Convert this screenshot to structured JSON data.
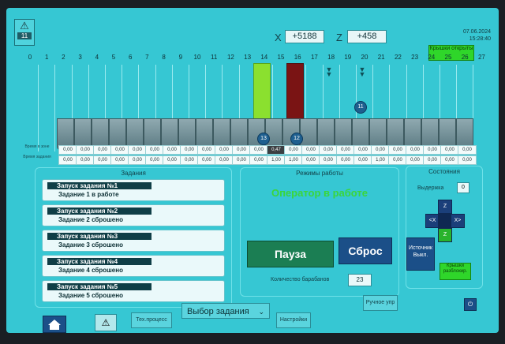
{
  "header": {
    "alarm_count": "11",
    "x_label": "X",
    "x_value": "+5188",
    "z_label": "Z",
    "z_value": "+458",
    "date": "07.06.2024",
    "time": "15:28:40",
    "green_button": "Крышки открыты"
  },
  "columns": [
    "0",
    "1",
    "2",
    "3",
    "4",
    "5",
    "6",
    "7",
    "8",
    "9",
    "10",
    "11",
    "12",
    "13",
    "14",
    "15",
    "16",
    "17",
    "18",
    "19",
    "20",
    "21",
    "22",
    "23",
    "24",
    "25",
    "26",
    "27"
  ],
  "markers": {
    "m13": "13",
    "m15": "12",
    "m19": "11"
  },
  "rows": {
    "row1_label": "Время в зоне",
    "row2_label": "Время задания",
    "row1": [
      "0,00",
      "0,00",
      "0,00",
      "0,00",
      "0,00",
      "0,00",
      "0,00",
      "0,00",
      "0,00",
      "0,00",
      "0,00",
      "0,00",
      "0,47",
      "0,00",
      "0,00",
      "0,00",
      "0,00",
      "0,00",
      "0,00",
      "0,00",
      "0,00",
      "0,00",
      "0,00",
      "0,00"
    ],
    "row2": [
      "0,00",
      "0,00",
      "0,00",
      "0,00",
      "0,00",
      "0,00",
      "0,00",
      "0,00",
      "0,00",
      "0,00",
      "0,00",
      "0,00",
      "1,00",
      "1,00",
      "0,00",
      "0,00",
      "0,00",
      "0,00",
      "1,00",
      "0,00",
      "0,00",
      "0,00",
      "0,00",
      "0,00"
    ]
  },
  "tasks": {
    "title": "Задания",
    "items": [
      {
        "head": "Запуск задания №1",
        "sub": "Задание 1 в работе"
      },
      {
        "head": "Запуск задания №2",
        "sub": "Задание 2 сброшено"
      },
      {
        "head": "Запуск задания №3",
        "sub": "Задание 3 сброшено"
      },
      {
        "head": "Запуск задания №4",
        "sub": "Задание 4 сброшено"
      },
      {
        "head": "Запуск задания №5",
        "sub": "Задание 5 сброшено"
      }
    ]
  },
  "modes": {
    "title": "Режимы работы",
    "status": "Оператор в работе",
    "pause": "Пауза",
    "reset": "Сброс",
    "qty_label": "Количество барабанов",
    "qty_value": "23"
  },
  "state": {
    "title": "Состояния",
    "hold_label": "Выдержка",
    "hold_value": "0",
    "up": "Z",
    "down": "Z",
    "left": "<X",
    "right": "X>",
    "source_btn": "Источник Выкл.",
    "green_btn": "Крышки разблокир."
  },
  "bottom": {
    "tech": "Тех.процесс",
    "select": "Выбор задания",
    "settings": "Настройки",
    "manual": "Ручное упр"
  }
}
